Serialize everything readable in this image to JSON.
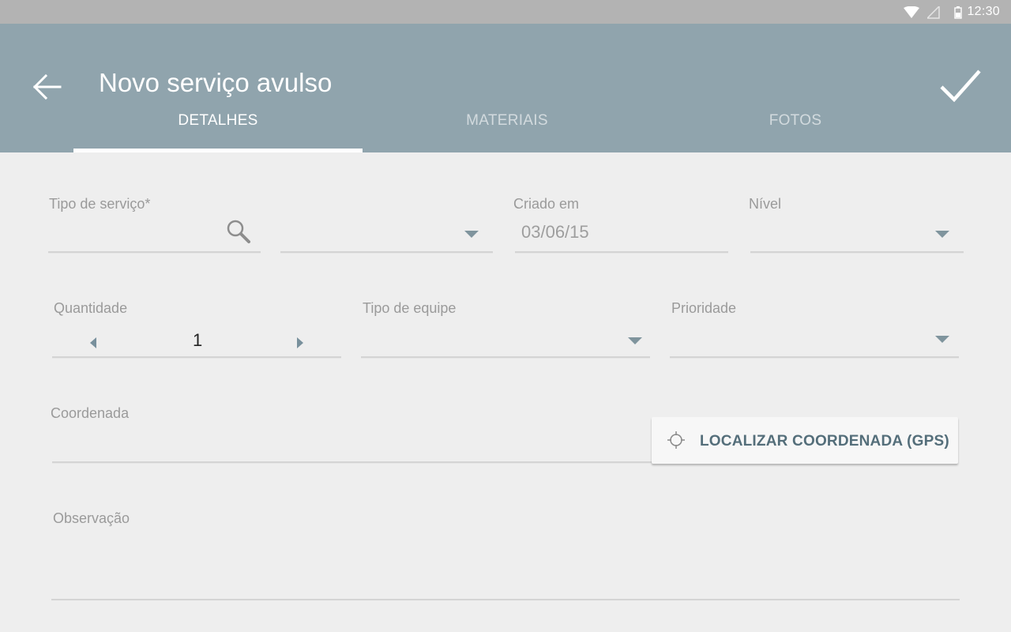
{
  "status_bar": {
    "time": "12:30"
  },
  "app_bar": {
    "title": "Novo serviço avulso"
  },
  "tabs": [
    {
      "label": "DETALHES"
    },
    {
      "label": "MATERIAIS"
    },
    {
      "label": "FOTOS"
    }
  ],
  "form": {
    "tipo_servico": {
      "label": "Tipo de serviço*",
      "value": ""
    },
    "criado_em": {
      "label": "Criado em",
      "value": "03/06/15"
    },
    "nivel": {
      "label": "Nível",
      "value": ""
    },
    "quantidade": {
      "label": "Quantidade",
      "value": "1"
    },
    "tipo_equipe": {
      "label": "Tipo de equipe",
      "value": ""
    },
    "prioridade": {
      "label": "Prioridade",
      "value": ""
    },
    "coordenada": {
      "label": "Coordenada",
      "value": ""
    },
    "gps_button": {
      "label": "LOCALIZAR COORDENADA (GPS)"
    },
    "observacao": {
      "label": "Observação",
      "value": ""
    }
  },
  "colors": {
    "app_bar": "#90a4ad",
    "status_bar": "#b3b3b3",
    "background": "#eeeeee",
    "accent_text": "#546e7a"
  },
  "icons": [
    "back-arrow-icon",
    "check-icon",
    "search-icon",
    "dropdown-arrow-icon",
    "crosshair-icon",
    "wifi-icon",
    "signal-icon",
    "battery-icon"
  ]
}
